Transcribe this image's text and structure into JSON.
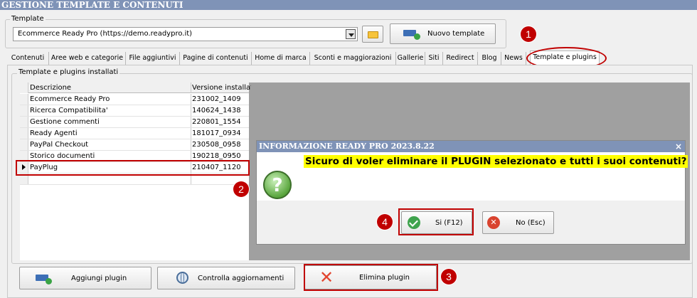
{
  "window": {
    "title": "GESTIONE TEMPLATE E CONTENUTI"
  },
  "template_group": {
    "label": "Template",
    "selected_value": "Ecommerce Ready Pro (https://demo.readypro.it)",
    "new_button": "Nuovo template"
  },
  "tabs": [
    {
      "label": "Contenuti"
    },
    {
      "label": "Aree web e categorie"
    },
    {
      "label": "File aggiuntivi"
    },
    {
      "label": "Pagine di contenuti"
    },
    {
      "label": "Home di marca"
    },
    {
      "label": "Sconti e maggiorazioni"
    },
    {
      "label": "Gallerie"
    },
    {
      "label": "Siti"
    },
    {
      "label": "Redirect"
    },
    {
      "label": "Blog"
    },
    {
      "label": "News"
    },
    {
      "label": "Template e plugins"
    }
  ],
  "plugins_group": {
    "label": "Template e plugins installati",
    "columns": [
      "Descrizione",
      "Versione installata"
    ],
    "rows": [
      {
        "name": "Ecommerce Ready Pro",
        "version": "231002_1409"
      },
      {
        "name": "Ricerca Compatibilita'",
        "version": "140624_1438"
      },
      {
        "name": "Gestione commenti",
        "version": "220801_1554"
      },
      {
        "name": "Ready Agenti",
        "version": "181017_0934"
      },
      {
        "name": "PayPal Checkout",
        "version": "230508_0958"
      },
      {
        "name": "Storico documenti",
        "version": "190218_0950"
      },
      {
        "name": "PayPlug",
        "version": "210407_1120"
      }
    ]
  },
  "actions": {
    "add_plugin": "Aggiungi plugin",
    "check_updates": "Controlla aggiornamenti",
    "delete_plugin": "Elimina plugin"
  },
  "dialog": {
    "title": "INFORMAZIONE READY PRO 2023.8.22",
    "close": "×",
    "message": "Sicuro di voler eliminare il PLUGIN selezionato e tutti i suoi contenuti?",
    "question_glyph": "?",
    "yes_button": "Si (F12)",
    "no_button": "No (Esc)"
  },
  "markers": [
    "1",
    "2",
    "3",
    "4"
  ],
  "colors": {
    "titlebar": "#7f93b7",
    "highlight": "#c00000",
    "message_bg": "#ffff00"
  }
}
